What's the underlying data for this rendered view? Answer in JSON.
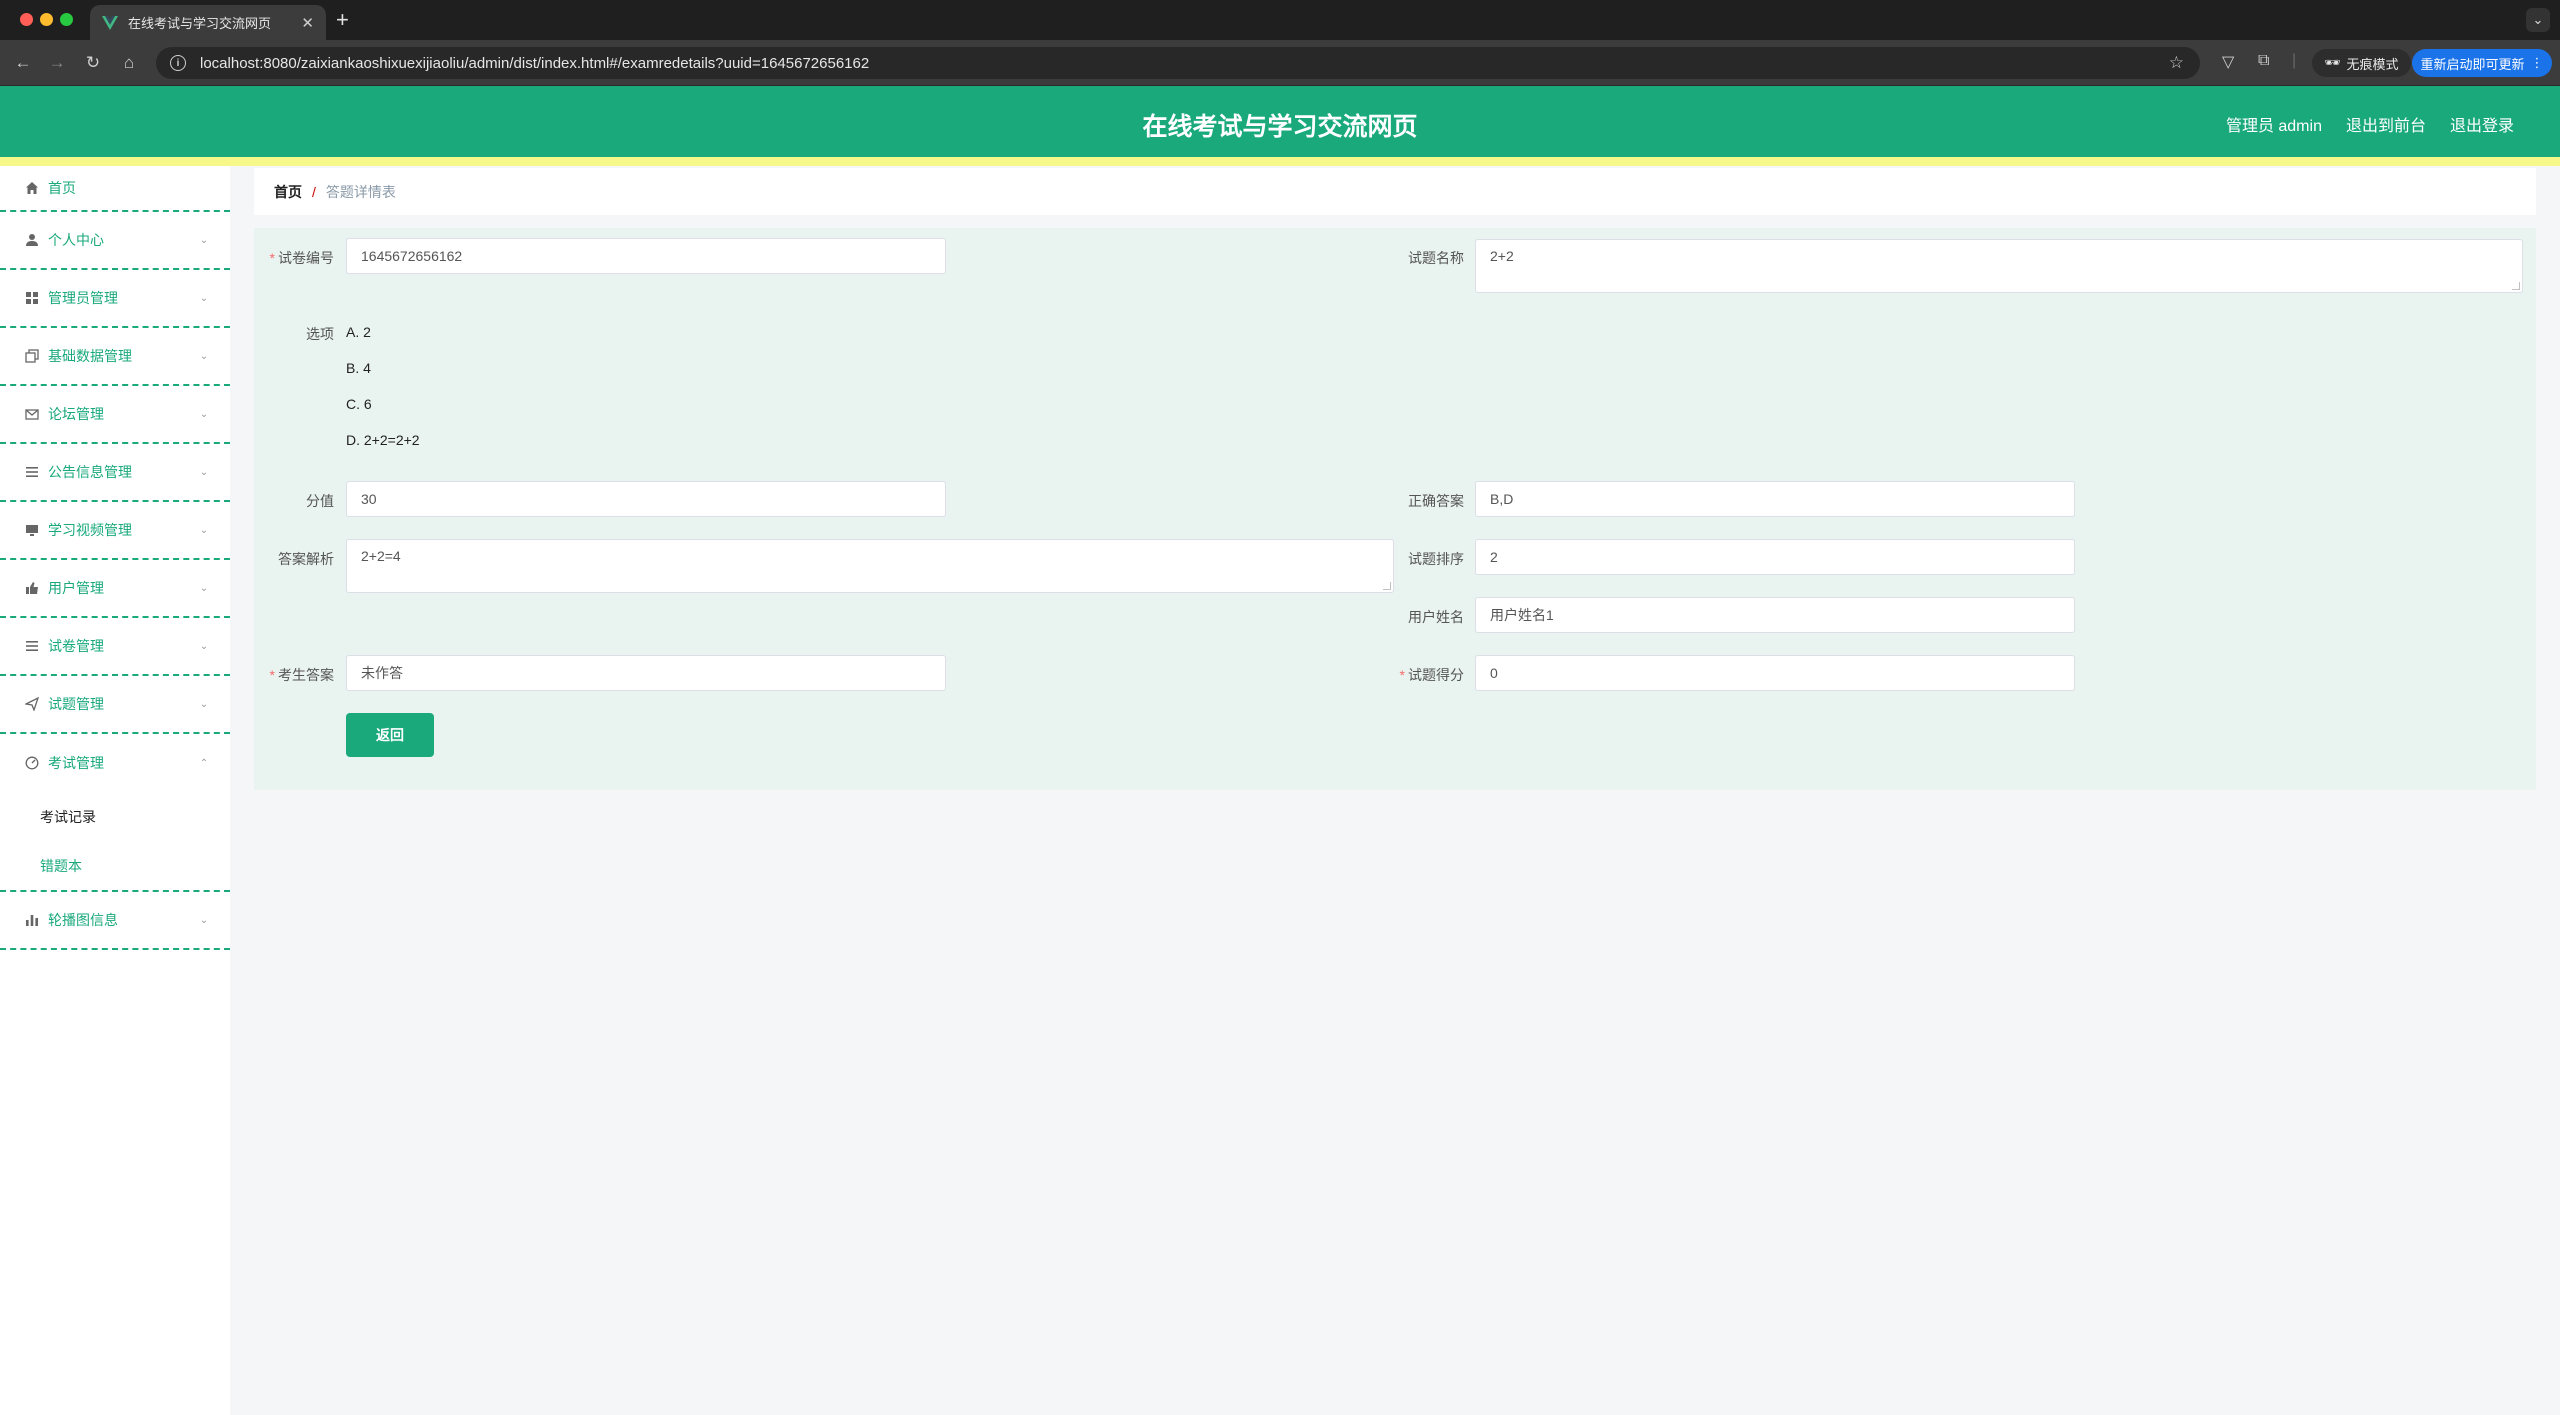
{
  "browser": {
    "tab_title": "在线考试与学习交流网页",
    "url": "localhost:8080/zaixiankaoshixuexijiaoliu/admin/dist/index.html#/examredetails?uuid=1645672656162",
    "incognito_label": "无痕模式",
    "update_label": "重新启动即可更新"
  },
  "header": {
    "title": "在线考试与学习交流网页",
    "user_label": "管理员 admin",
    "front_link": "退出到前台",
    "logout_link": "退出登录"
  },
  "sidebar": {
    "items": [
      {
        "label": "首页",
        "icon": "home-icon"
      },
      {
        "label": "个人中心",
        "icon": "user-icon"
      },
      {
        "label": "管理员管理",
        "icon": "grid-icon"
      },
      {
        "label": "基础数据管理",
        "icon": "copy-icon"
      },
      {
        "label": "论坛管理",
        "icon": "mail-icon"
      },
      {
        "label": "公告信息管理",
        "icon": "list-icon"
      },
      {
        "label": "学习视频管理",
        "icon": "monitor-icon"
      },
      {
        "label": "用户管理",
        "icon": "thumb-icon"
      },
      {
        "label": "试卷管理",
        "icon": "list-icon"
      },
      {
        "label": "试题管理",
        "icon": "send-icon"
      },
      {
        "label": "考试管理",
        "icon": "gauge-icon"
      },
      {
        "label": "轮播图信息",
        "icon": "chart-icon"
      }
    ],
    "exam_sub": [
      "考试记录",
      "错题本"
    ]
  },
  "breadcrumb": {
    "home": "首页",
    "separator": "/",
    "current": "答题详情表"
  },
  "form": {
    "paper_id_label": "试卷编号",
    "paper_id_value": "1645672656162",
    "question_name_label": "试题名称",
    "question_name_value": "2+2",
    "options_label": "选项",
    "options": [
      "A. 2",
      "B. 4",
      "C. 6",
      "D. 2+2=2+2"
    ],
    "score_label": "分值",
    "score_value": "30",
    "correct_label": "正确答案",
    "correct_value": "B,D",
    "analysis_label": "答案解析",
    "analysis_value": "2+2=4",
    "order_label": "试题排序",
    "order_value": "2",
    "username_label": "用户姓名",
    "username_value": "用户姓名1",
    "student_answer_label": "考生答案",
    "student_answer_value": "未作答",
    "question_score_label": "试题得分",
    "question_score_value": "0",
    "back_label": "返回"
  }
}
